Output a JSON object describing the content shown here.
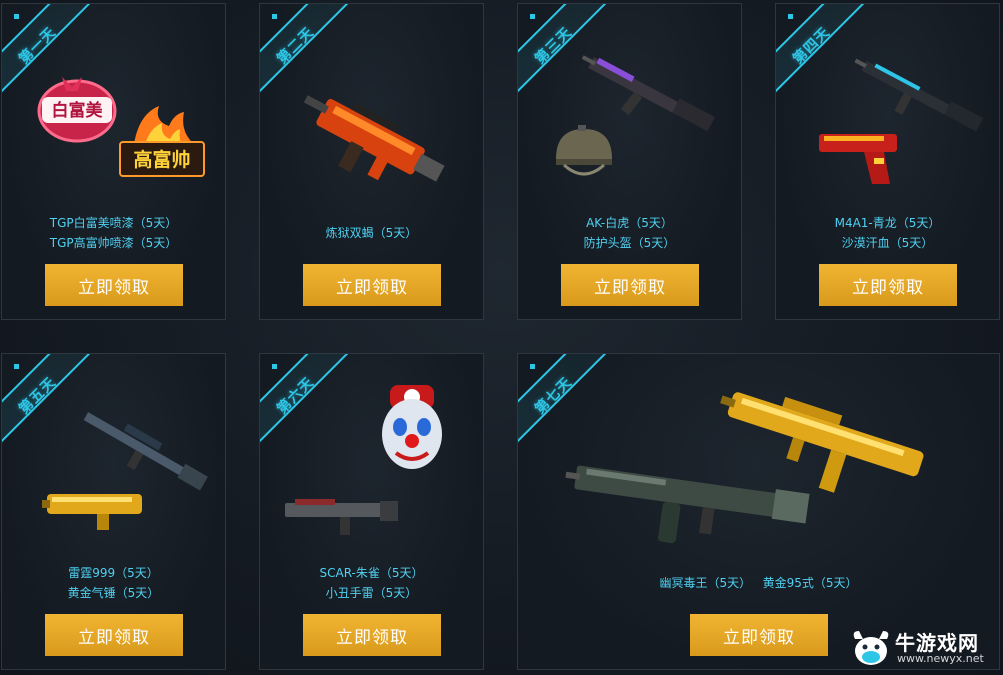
{
  "colors": {
    "accent": "#2ec6e6",
    "button": "#e0a628",
    "prize_text": "#4fd0f0"
  },
  "cards": [
    {
      "day": "第一天",
      "lines": [
        "TGP白富美喷漆（5天）",
        "TGP高富帅喷漆（5天）"
      ],
      "button": "立即领取",
      "icons": [
        "bai-fu-mei-spray-icon",
        "gao-fu-shuai-spray-icon"
      ]
    },
    {
      "day": "第二天",
      "lines": [
        "炼狱双蝎（5天）"
      ],
      "button": "立即领取",
      "icons": [
        "smg-icon"
      ]
    },
    {
      "day": "第三天",
      "lines": [
        "AK-白虎（5天）",
        "防护头盔（5天）"
      ],
      "button": "立即领取",
      "icons": [
        "rifle-icon",
        "helmet-icon"
      ]
    },
    {
      "day": "第四天",
      "lines": [
        "M4A1-青龙（5天）",
        "沙漠汗血（5天）"
      ],
      "button": "立即领取",
      "icons": [
        "rifle-icon",
        "pistol-icon"
      ]
    },
    {
      "day": "第五天",
      "lines": [
        "雷霆999（5天）",
        "黄金气锤（5天）"
      ],
      "button": "立即领取",
      "icons": [
        "sniper-rifle-icon",
        "gold-shotgun-icon"
      ]
    },
    {
      "day": "第六天",
      "lines": [
        "SCAR-朱雀（5天）",
        "小丑手雷（5天）"
      ],
      "button": "立即领取",
      "icons": [
        "clown-grenade-icon",
        "rifle-icon"
      ]
    },
    {
      "day": "第七天",
      "lines": [
        "幽冥毒王（5天）   黄金95式（5天）"
      ],
      "button": "立即领取",
      "icons": [
        "gold-rifle-icon",
        "machine-gun-icon"
      ]
    }
  ],
  "watermark": {
    "text": "牛游戏网",
    "url": "www.newyx.net"
  }
}
